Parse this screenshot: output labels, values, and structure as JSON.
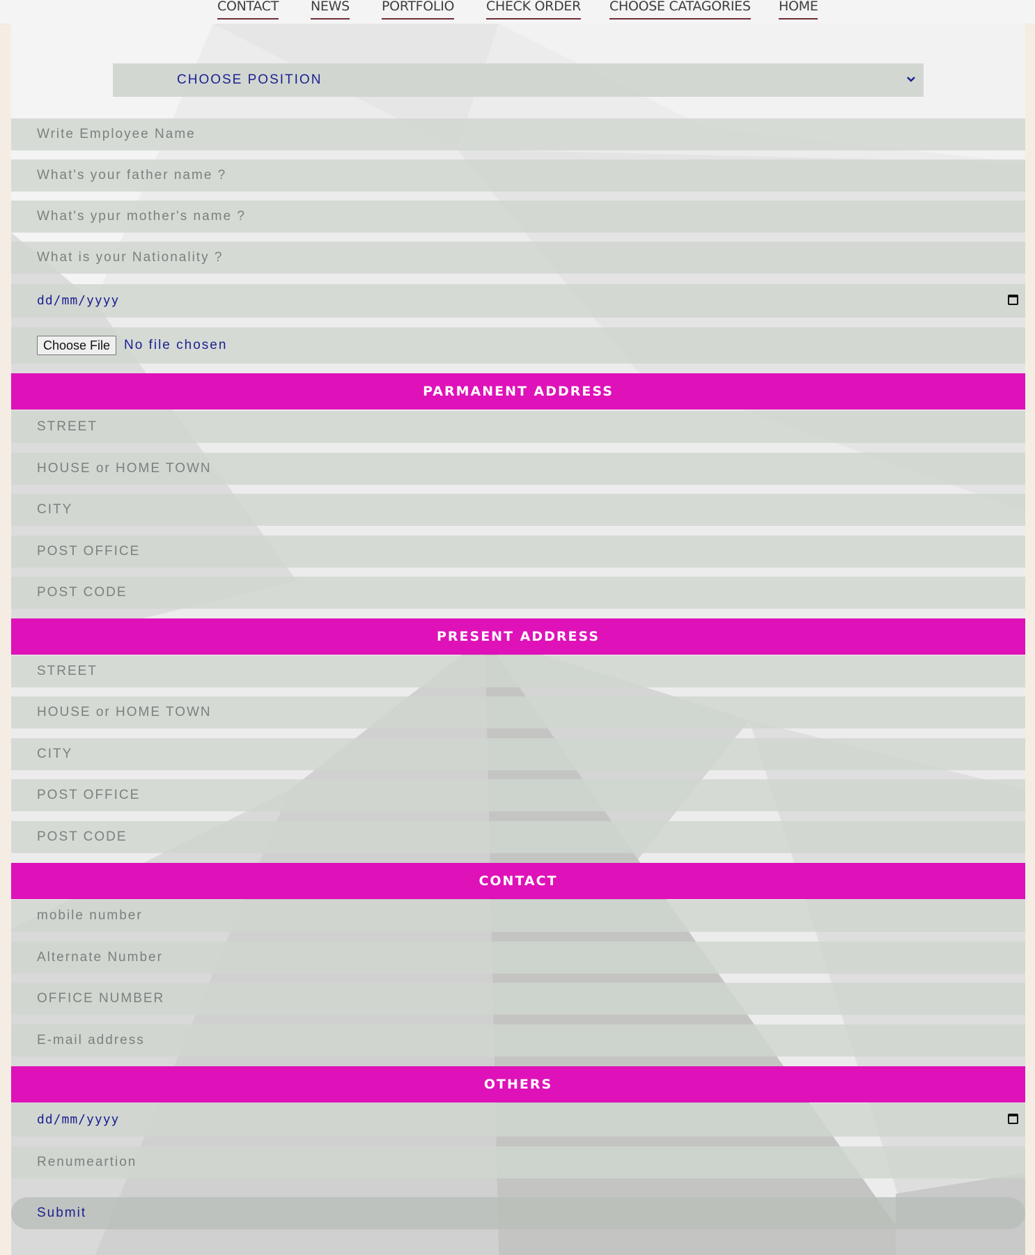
{
  "nav": {
    "items": [
      "CONTACT",
      "NEWS",
      "PORTFOLIO",
      "CHECK ORDER",
      "CHOOSE CATAGORIES",
      "HOME"
    ]
  },
  "position_select": {
    "label": "CHOOSE POSITION"
  },
  "personal": {
    "employee_name": "Write Employee Name",
    "father_name": "What's your father name ?",
    "mother_name": "What's ypur mother's name ?",
    "nationality": "What is your Nationality ?",
    "birth_date": "dd/mm/yyyy",
    "file_button": "Choose File",
    "file_status": "No file chosen"
  },
  "permanent_address": {
    "heading": "PARMANENT ADDRESS",
    "street": "STREET",
    "house": "HOUSE or HOME TOWN",
    "city": "CITY",
    "post_office": "POST OFFICE",
    "post_code": "POST CODE"
  },
  "present_address": {
    "heading": "PRESENT ADDRESS",
    "street": "STREET",
    "house": "HOUSE or HOME TOWN",
    "city": "CITY",
    "post_office": "POST OFFICE",
    "post_code": "POST CODE"
  },
  "contact": {
    "heading": "CONTACT",
    "mobile": "mobile number",
    "alternate": "Alternate Number",
    "office": "OFFICE NUMBER",
    "email": "E-mail address"
  },
  "others": {
    "heading": "OTHERS",
    "date": "dd/mm/yyyy",
    "renumeration": "Renumeartion"
  },
  "submit": {
    "label": "Submit"
  },
  "colors": {
    "section_bg": "#de12b8",
    "field_bg": "#d0d5d0",
    "link_text": "#1c2190",
    "nav_underline": "#6f2c34",
    "page_bg": "#f5ede3"
  }
}
